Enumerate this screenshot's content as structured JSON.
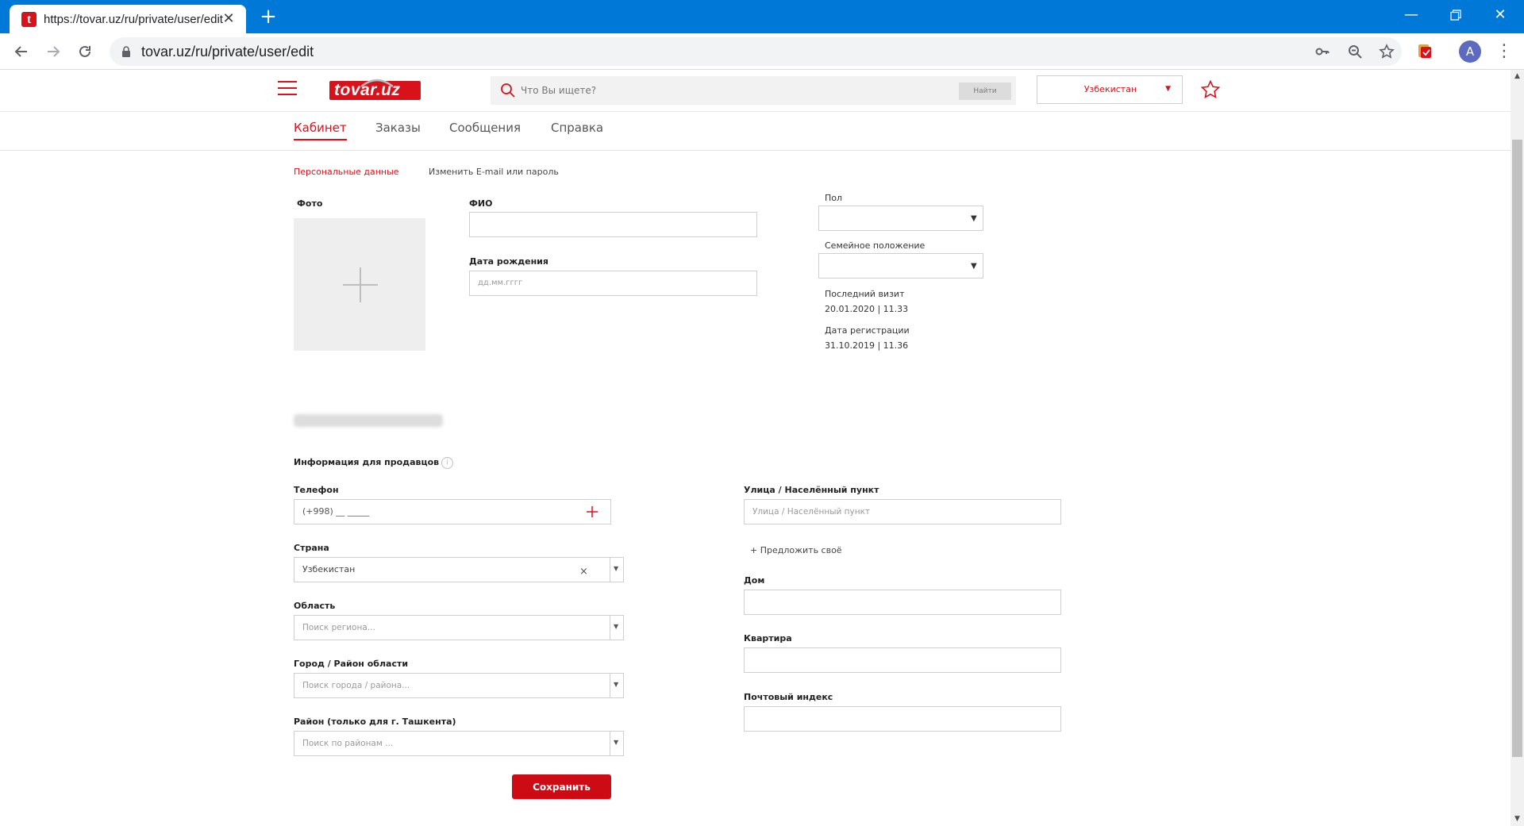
{
  "browser": {
    "tab_title": "https://tovar.uz/ru/private/user/edit",
    "tab_favicon_letter": "t",
    "new_tab_symbol": "+",
    "url": "tovar.uz/ru/private/user/edit",
    "avatar_letter": "A"
  },
  "header": {
    "logo_text": "tovar.uz",
    "search_placeholder": "Что Вы ищете?",
    "search_button": "Найти",
    "country": "Узбекистан"
  },
  "cabinet_tabs": [
    {
      "label": "Кабинет",
      "active": true
    },
    {
      "label": "Заказы",
      "active": false
    },
    {
      "label": "Сообщения",
      "active": false
    },
    {
      "label": "Справка",
      "active": false
    }
  ],
  "sub_tabs": {
    "personal": "Персональные данные",
    "change_credentials": "Изменить E-mail или пароль"
  },
  "profile": {
    "photo_label": "Фото",
    "name_label": "ФИО",
    "birth_label": "Дата рождения",
    "birth_placeholder": "дд.мм.гггг",
    "gender_label": "Пол",
    "marital_label": "Семейное положение",
    "last_visit_label": "Последний визит",
    "last_visit_value": "20.01.2020 | 11.33",
    "registered_label": "Дата регистрации",
    "registered_value": "31.10.2019 | 11.36"
  },
  "seller": {
    "section_title": "Информация для продавцов",
    "info_symbol": "i",
    "phone_label": "Телефон",
    "phone_value": "(+998) __ _____",
    "country_label": "Страна",
    "country_value": "Узбекистан",
    "region_label": "Область",
    "region_placeholder": "Поиск региона...",
    "city_label": "Город / Район области",
    "city_placeholder": "Поиск города / района...",
    "district_label": "Район (только для г. Ташкента)",
    "district_placeholder": "Поиск по районам ...",
    "street_label": "Улица / Населённый пункт",
    "street_placeholder": "Улица / Населённый пункт",
    "suggest_link": "+ Предложить своё",
    "house_label": "Дом",
    "apartment_label": "Квартира",
    "postal_label": "Почтовый индекс",
    "save_button": "Сохранить"
  },
  "colors": {
    "brand_red": "#d8111b",
    "chrome_blue": "#0078d7"
  }
}
